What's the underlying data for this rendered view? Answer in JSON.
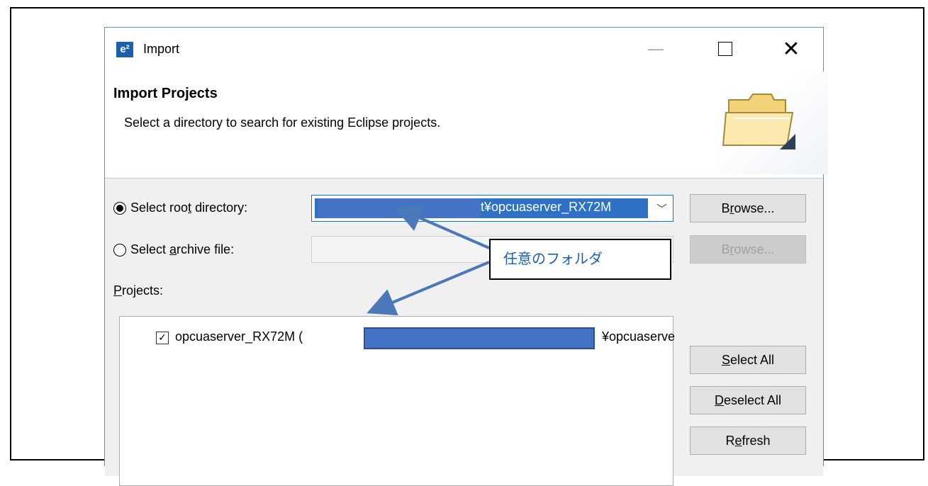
{
  "window": {
    "title": "Import",
    "app_icon": "e²"
  },
  "header": {
    "title": "Import Projects",
    "description": "Select a directory to search for existing Eclipse projects."
  },
  "root_dir": {
    "label_pre": "Select roo",
    "label_key": "t",
    "label_post": " directory:",
    "selected": true,
    "value_visible": "t¥opcuaserver_RX72M"
  },
  "archive": {
    "label_pre": "Select ",
    "label_key": "a",
    "label_post": "rchive file:",
    "selected": false,
    "value": ""
  },
  "buttons": {
    "browse_1": {
      "pre": "B",
      "key": "r",
      "post": "owse..."
    },
    "browse_2": {
      "pre": "B",
      "key": "r",
      "post": "owse..."
    },
    "select_all": {
      "pre": "",
      "key": "S",
      "post": "elect All"
    },
    "deselect_all": {
      "pre": "",
      "key": "D",
      "post": "eselect All"
    },
    "refresh": {
      "pre": "R",
      "key": "e",
      "post": "fresh"
    }
  },
  "projects": {
    "label_key": "P",
    "label_post": "rojects:",
    "items": [
      {
        "checked": true,
        "name_start": "opcuaserver_RX72M (",
        "name_end": "¥opcuaserve"
      }
    ]
  },
  "callout": {
    "text": "任意のフォルダ"
  },
  "colors": {
    "accent": "#0078d7",
    "redaction": "#4472c4",
    "callout_text": "#1f5fb0"
  },
  "icons": [
    "app-icon",
    "minimize-icon",
    "maximize-icon",
    "close-icon",
    "folder-icon",
    "combo-dropdown-icon",
    "checkbox-icon"
  ]
}
